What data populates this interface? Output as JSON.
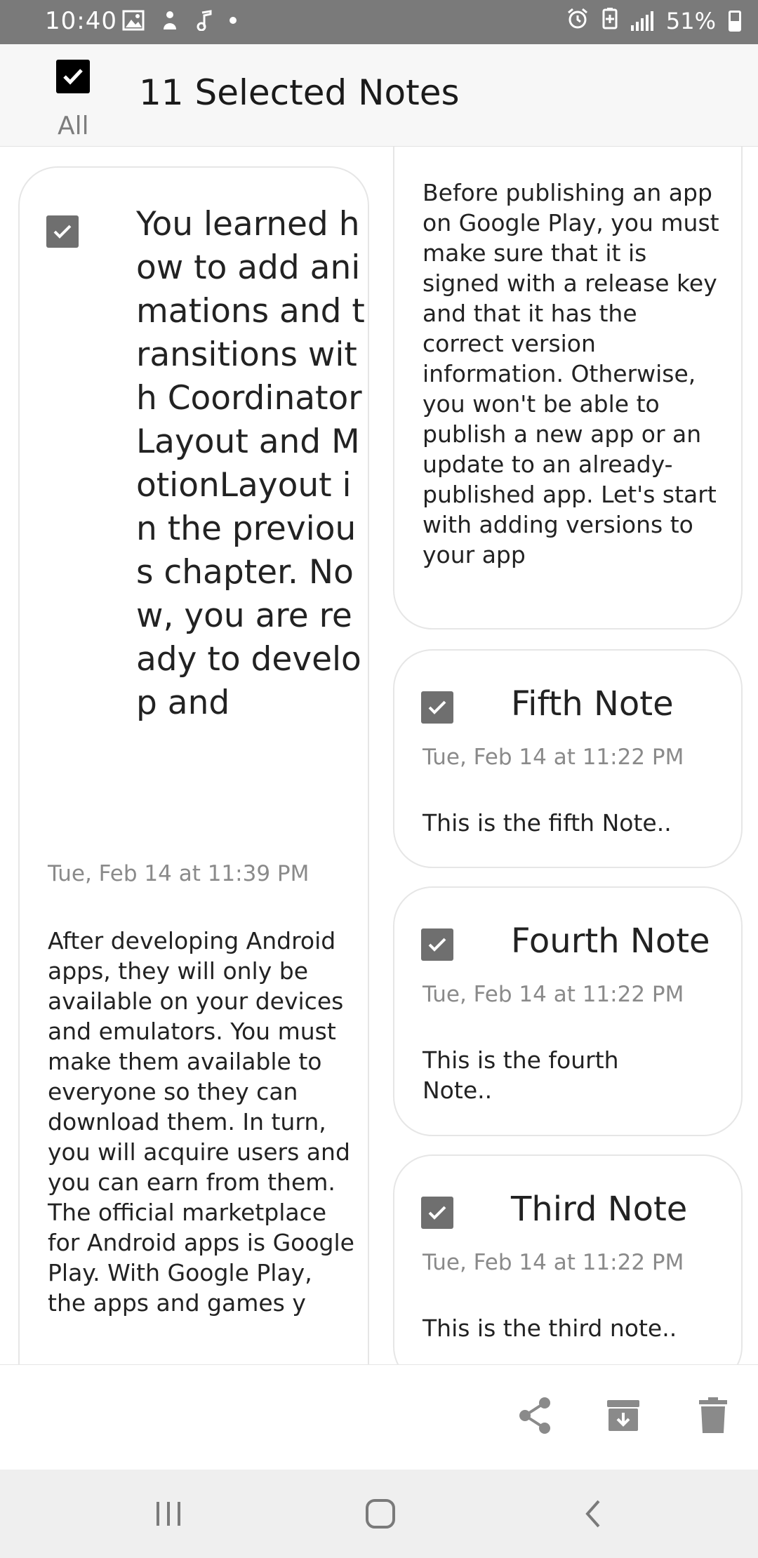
{
  "status_bar": {
    "time": "10:40",
    "battery": "51%"
  },
  "header": {
    "select_all_label": "All",
    "title": "11 Selected Notes"
  },
  "notes": {
    "left_top": {
      "title": "You learned how to add animations and transitions with CoordinatorLayout and MotionLayout in the previous chapter. Now, you are ready to develop and",
      "date": "Tue, Feb 14 at 11:39 PM",
      "body": "After developing Android apps, they will only be available on your devices and emulators. You must make them available to everyone so they can download them. In turn, you will acquire users and you can earn from them. The official marketplace for Android apps is Google Play. With Google Play, the apps and games y"
    },
    "right_top": {
      "body": "Before publishing an app on Google Play, you must make sure that it is signed with a release key and that it has the correct version information. Otherwise, you won't be able to publish a new app or an update to an already-published app. Let's start with adding versions to your app"
    },
    "fifth": {
      "title": "Fifth Note",
      "date": "Tue, Feb 14 at 11:22 PM",
      "body": "This is the fifth Note.."
    },
    "fourth": {
      "title": "Fourth Note",
      "date": "Tue, Feb 14 at 11:22 PM",
      "body": "This is the fourth Note.."
    },
    "third": {
      "title": "Third Note",
      "date": "Tue, Feb 14 at 11:22 PM",
      "body": "This is the third note.."
    }
  },
  "colors": {
    "status_bar_bg": "#7a7a7a",
    "header_bg": "#f7f7f7",
    "checkbox_fill": "#6f6f6f",
    "action_icon": "#8a8a8a",
    "nav_bar_bg": "#efefef"
  }
}
